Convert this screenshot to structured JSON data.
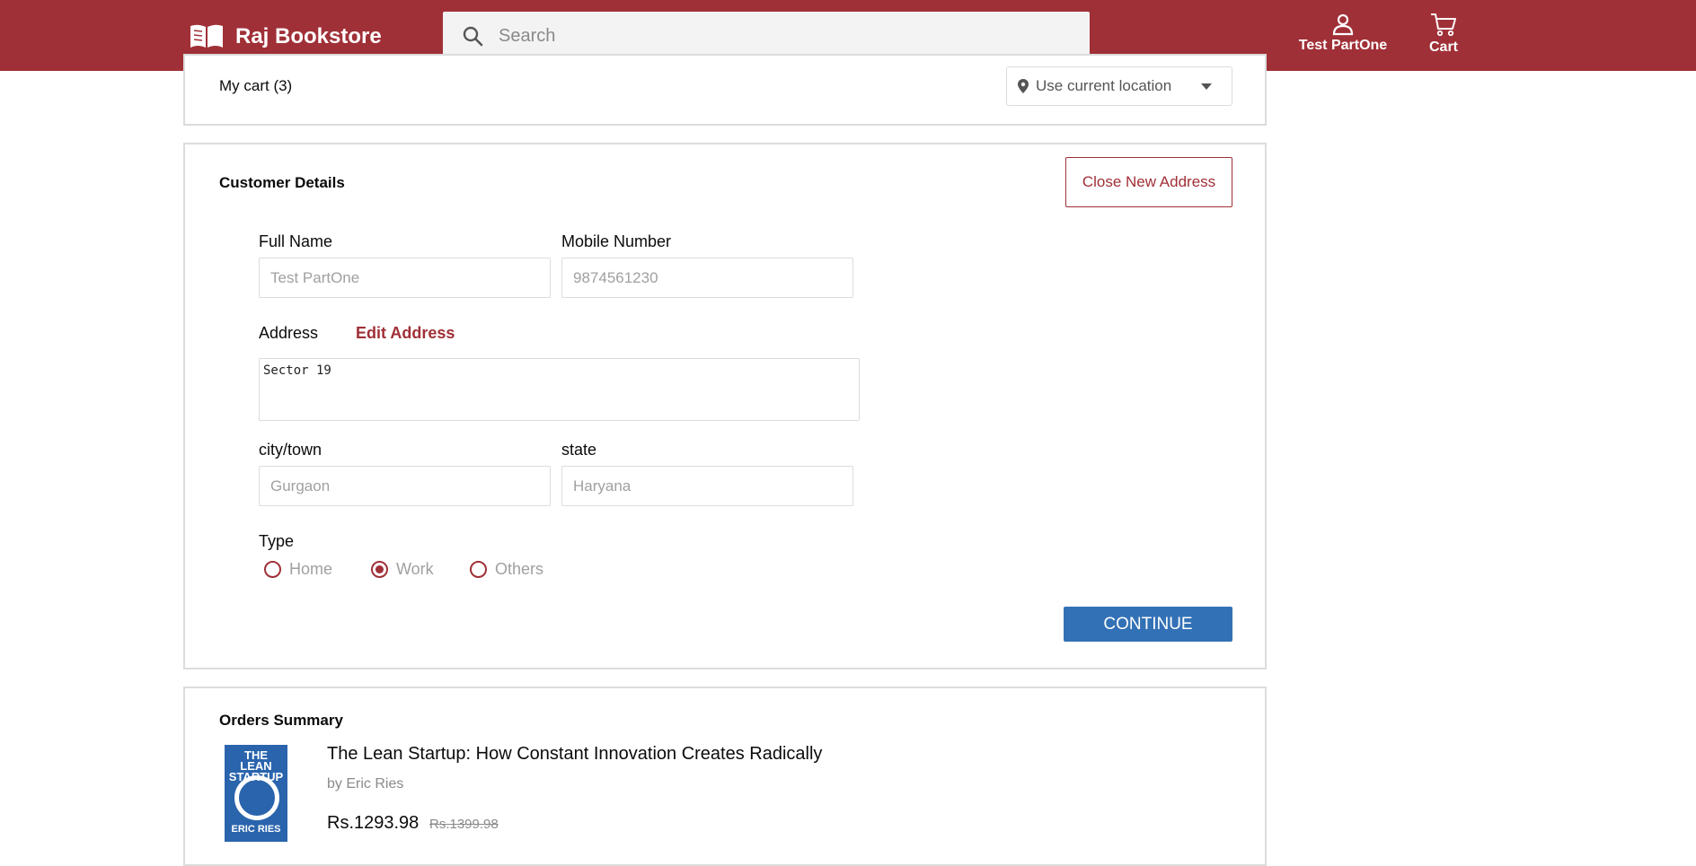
{
  "header": {
    "brand": "Raj Bookstore",
    "search_placeholder": "Search",
    "user_label": "Test PartOne",
    "cart_label": "Cart"
  },
  "cart_bar": {
    "title": "My cart (3)",
    "location_label": "Use current location"
  },
  "customer": {
    "title": "Customer Details",
    "close_button": "Close New Address",
    "full_name_label": "Full Name",
    "full_name_placeholder": "Test PartOne",
    "mobile_label": "Mobile Number",
    "mobile_placeholder": "9874561230",
    "address_label": "Address",
    "edit_address": "Edit Address",
    "address_value": "Sector 19",
    "city_label": "city/town",
    "city_placeholder": "Gurgaon",
    "state_label": "state",
    "state_placeholder": "Haryana",
    "type_label": "Type",
    "type_options": [
      "Home",
      "Work",
      "Others"
    ],
    "type_selected": "Work",
    "continue_button": "CONTINUE"
  },
  "orders": {
    "title": "Orders Summary",
    "items": [
      {
        "cover_title": "THE LEAN STARTUP",
        "cover_author": "ERIC RIES",
        "title": "The Lean Startup: How Constant Innovation Creates Radically",
        "author": "by Eric Ries",
        "price": "Rs.1293.98",
        "mrp": "Rs.1399.98"
      }
    ]
  },
  "colors": {
    "brand": "#a03037",
    "button_primary": "#3371b6"
  }
}
